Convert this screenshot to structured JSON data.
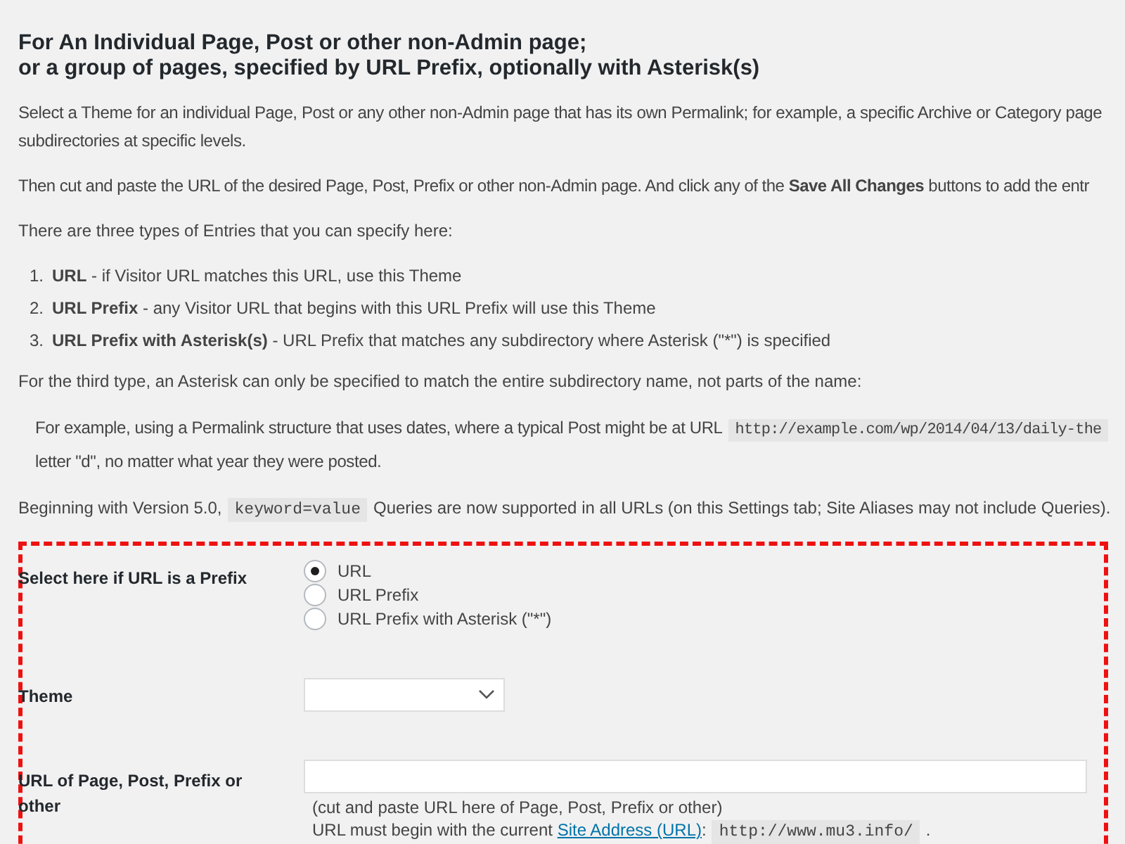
{
  "heading": "For An Individual Page, Post or other non-Admin page;\nor a group of pages, specified by URL Prefix, optionally with Asterisk(s)",
  "intro": "Select a Theme for an individual Page, Post or any other non-Admin page that has its own Permalink; for example, a specific Archive or Category page\nsubdirectories at specific levels.",
  "instructions": "Then cut and paste the URL of the desired Page, Post, Prefix or other non-Admin page. And click any of the **Save All Changes** buttons to add the entr",
  "types_intro": "There are three types of Entries that you can specify here:",
  "types": [
    {
      "number": "1.",
      "text": "**URL** - if Visitor URL matches this URL, use this Theme"
    },
    {
      "number": "2.",
      "text": "**URL Prefix** - any Visitor URL that begins with this URL Prefix will use this Theme"
    },
    {
      "number": "3.",
      "text": "**URL Prefix with Asterisk(s)** - URL Prefix that matches any subdirectory where Asterisk (\"*\") is specified"
    }
  ],
  "third_type_note": "For the third type, an Asterisk can only be specified to match the entire subdirectory name, not parts of the name:",
  "example": {
    "before": "For example, using a Permalink structure that uses dates, where a typical Post might be at URL",
    "code": "http://example.com/wp/2014/04/13/daily-the",
    "after": "letter \"d\", no matter what year they were posted."
  },
  "version_note": {
    "before": "Beginning with Version 5.0,",
    "code": "keyword=value",
    "after": "Queries are now supported in all URLs (on this Settings tab; Site Aliases may not include Queries)."
  },
  "form": {
    "prefix_label": "Select here if URL is a Prefix",
    "prefix_options": [
      {
        "label": "URL",
        "selected": true
      },
      {
        "label": "URL Prefix",
        "selected": false
      },
      {
        "label": "URL Prefix with Asterisk (\"*\")",
        "selected": false
      }
    ],
    "theme_label": "Theme",
    "url_label": "URL of Page, Post, Prefix or other",
    "url_hint": "(cut and paste URL here of Page, Post, Prefix or other)",
    "site_note": {
      "before": "URL must begin with the current",
      "link": "Site Address (URL)",
      "colon": ":",
      "code": "http://www.mu3.info/",
      "after": "."
    }
  }
}
